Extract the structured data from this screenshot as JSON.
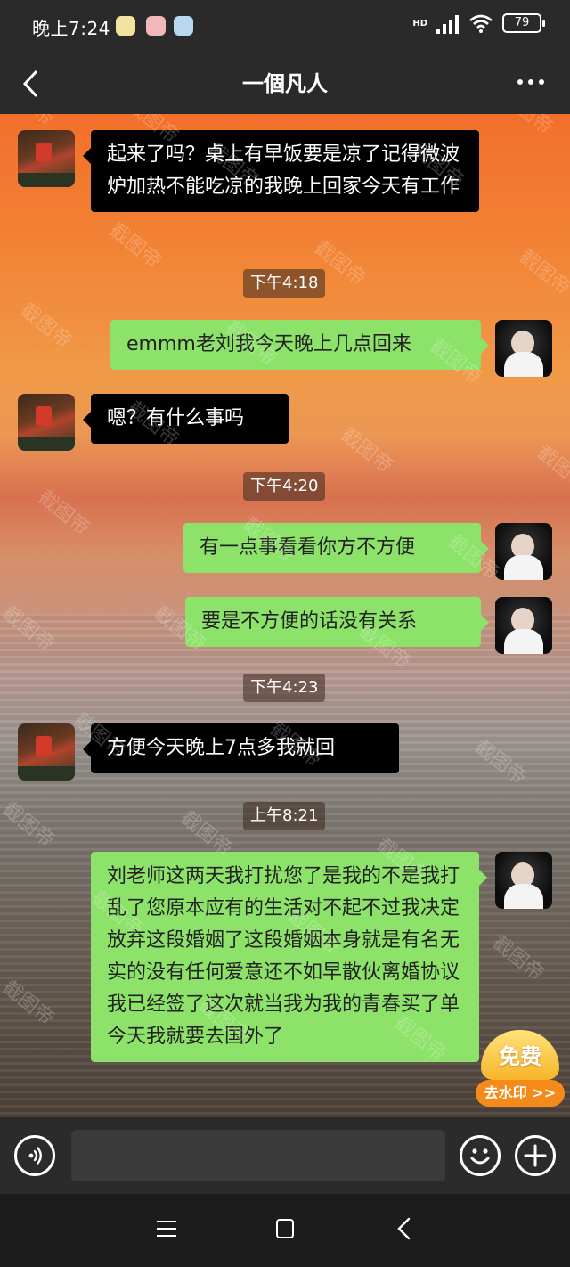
{
  "status_bar": {
    "time": "晚上7:24",
    "network": "HD",
    "battery": "79"
  },
  "header": {
    "title": "一個凡人"
  },
  "messages": [
    {
      "sender": "other",
      "text": "起来了吗？桌上有早饭要是凉了记得微波炉加热不能吃凉的我晚上回家今天有工作"
    },
    {
      "type": "time",
      "text": "下午4:18"
    },
    {
      "sender": "me",
      "text": "emmm老刘我今天晚上几点回来"
    },
    {
      "sender": "other",
      "text": "嗯？有什么事吗"
    },
    {
      "type": "time",
      "text": "下午4:20"
    },
    {
      "sender": "me",
      "text": "有一点事看看你方不方便"
    },
    {
      "sender": "me",
      "text": "要是不方便的话没有关系"
    },
    {
      "type": "time",
      "text": "下午4:23"
    },
    {
      "sender": "other",
      "text": "方便今天晚上7点多我就回"
    },
    {
      "type": "time",
      "text": "上午8:21"
    },
    {
      "sender": "me",
      "text": "刘老师这两天我打扰您了是我的不是我打乱了您原本应有的生活对不起不过我决定放弃这段婚姻了这段婚姻本身就是有名无实的没有任何爱意还不如早散伙离婚协议我已经签了这次就当我为我的青春买了单今天我就要去国外了"
    }
  ],
  "watermark_text": "截图帝",
  "free_badge": {
    "top": "免费",
    "bottom": "去水印 >>"
  },
  "input": {
    "value": "",
    "placeholder": ""
  },
  "colors": {
    "my_bubble": "#8de26a",
    "other_bubble": "#000000",
    "bar": "#2b2b2b"
  }
}
